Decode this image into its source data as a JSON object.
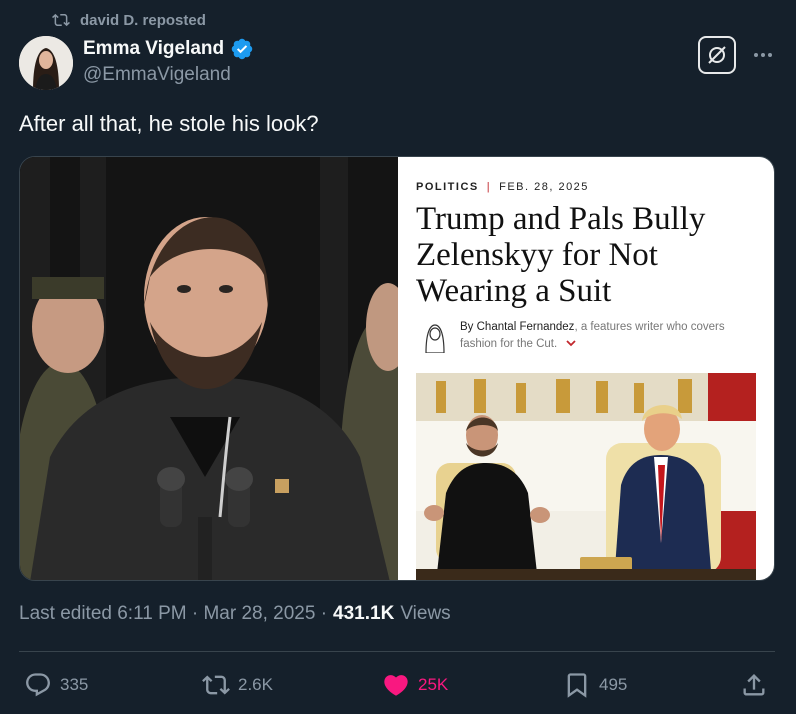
{
  "repost": {
    "text": "david D. reposted",
    "icon": "repost-icon"
  },
  "author": {
    "name": "Emma Vigeland",
    "handle": "@EmmaVigeland",
    "verified": true
  },
  "tweet": {
    "text": "After all that, he stole his look?"
  },
  "article": {
    "section": "POLITICS",
    "date": "FEB. 28, 2025",
    "title": "Trump and Pals Bully Zelenskyy for Not Wearing a Suit",
    "byline_author": "By Chantal Fernandez",
    "byline_rest": ", a features writer who covers fashion for the Cut."
  },
  "meta": {
    "edited": "Last edited 6:11 PM · Mar 28, 2025 ·",
    "views_count": "431.1K",
    "views_label": "Views"
  },
  "actions": {
    "replies": "335",
    "reposts": "2.6K",
    "likes": "25K",
    "bookmarks": "495"
  },
  "colors": {
    "background": "#15202b",
    "muted": "#8b98a5",
    "accent": "#1d9bf0",
    "like": "#f91880"
  }
}
